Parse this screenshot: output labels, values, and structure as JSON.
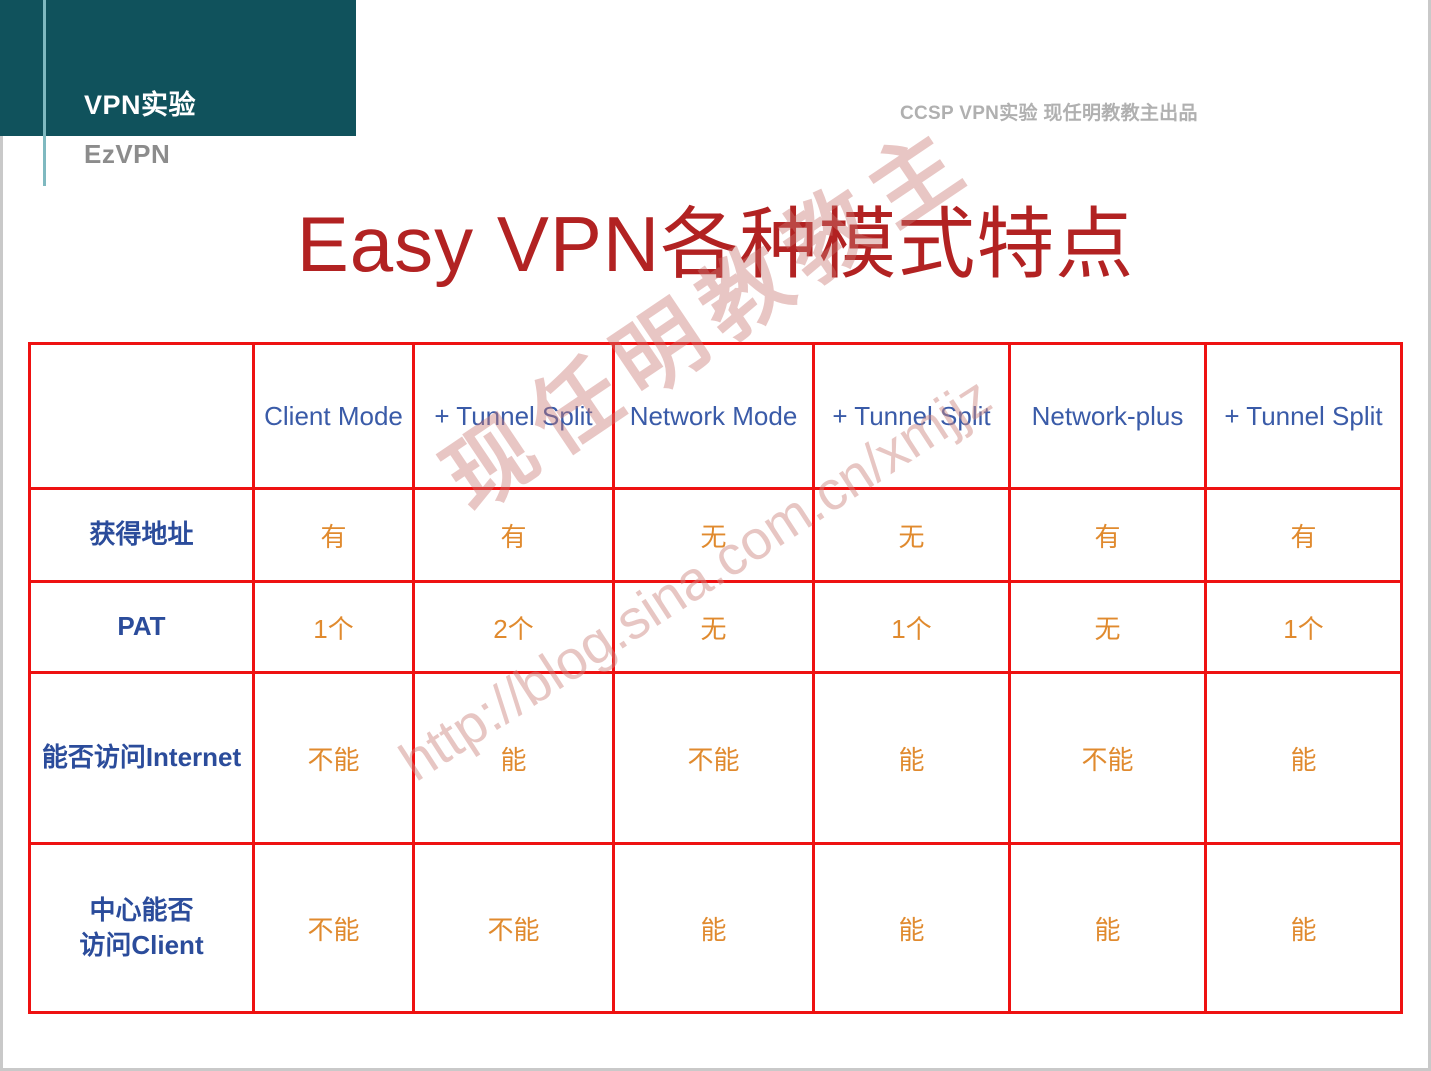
{
  "header": {
    "title": "VPN实验",
    "subtitle": "EzVPN",
    "credit": "CCSP VPN实验 现任明教教主出品",
    "band_color": "#10525c",
    "rule_color": "#7fb9c0"
  },
  "slide": {
    "title": "Easy VPN各种模式特点",
    "title_color": "#b22222"
  },
  "watermark": {
    "chars": "现任明教教主",
    "url": "http://blog.sina.com.cn/xmjjz"
  },
  "table": {
    "border_color": "#ee1111",
    "header_text_color": "#3a5ba8",
    "row_label_color": "#2b4c9b",
    "value_color": "#e08a2e",
    "corner_label": "",
    "columns": [
      "Client Mode",
      "+ Tunnel Split",
      "Network Mode",
      "+ Tunnel Split",
      "Network-plus",
      "+ Tunnel Split"
    ],
    "rows": [
      {
        "label": "获得地址",
        "label_parts": [
          "获得地址"
        ],
        "values": [
          "有",
          "有",
          "无",
          "无",
          "有",
          "有"
        ]
      },
      {
        "label": "PAT",
        "label_parts": [
          "PAT"
        ],
        "values": [
          "1个",
          "2个",
          "无",
          "1个",
          "无",
          "1个"
        ]
      },
      {
        "label": "能否访问Internet",
        "label_parts": [
          "能否访问Internet"
        ],
        "values": [
          "不能",
          "能",
          "不能",
          "能",
          "不能",
          "能"
        ]
      },
      {
        "label": "中心能否访问Client",
        "label_parts": [
          "中心能否",
          "访问Client"
        ],
        "values": [
          "不能",
          "不能",
          "能",
          "能",
          "能",
          "能"
        ]
      }
    ]
  }
}
